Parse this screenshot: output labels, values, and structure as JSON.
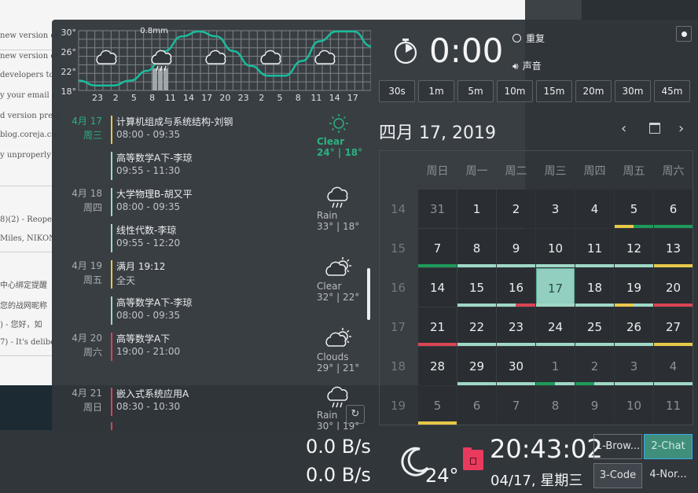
{
  "background": {
    "lines": [
      {
        "text": "new version of",
        "y": 40
      },
      {
        "text": "new version of",
        "y": 66
      },
      {
        "text": "developers to",
        "y": 90
      },
      {
        "text": "y your email s",
        "y": 116
      },
      {
        "text": "d version pre-c",
        "y": 142
      },
      {
        "text": "blog.coreja.co",
        "y": 166
      },
      {
        "text": "y unproperly (",
        "y": 192
      },
      {
        "text": "8)(2)  - Reope",
        "y": 274
      },
      {
        "text": "Miles, NIKON",
        "y": 298
      },
      {
        "text": "中心绑定提醒",
        "y": 354
      },
      {
        "text": "您的战网昵称",
        "y": 380
      },
      {
        "text": ")  - 您好，如",
        "y": 404
      },
      {
        "text": "7)  - It's delibe",
        "y": 430
      }
    ]
  },
  "weather_chart": {
    "rain_label": "0.8mm",
    "y_ticks": [
      "30°",
      "26°",
      "22°",
      "18°"
    ],
    "x_ticks": [
      "23",
      "2",
      "5",
      "8",
      "11",
      "14",
      "17",
      "20",
      "23",
      "2",
      "5",
      "8",
      "11",
      "14",
      "17"
    ],
    "temps": [
      20,
      19,
      19,
      20,
      22,
      26,
      29,
      30,
      29,
      26,
      23,
      21,
      21,
      24,
      28,
      30,
      30,
      27
    ]
  },
  "events": [
    {
      "date": "4月 17",
      "weekday": "周三",
      "today": true,
      "items": [
        {
          "title": "计算机组成与系统结构-刘钢",
          "time": "08:00 - 09:35",
          "color": "#e8c84a"
        },
        {
          "title": "高等数学A下-李琼",
          "time": "09:55 - 11:30",
          "color": "#9fd9c6"
        }
      ]
    },
    {
      "date": "4月 18",
      "weekday": "周四",
      "items": [
        {
          "title": "大学物理B-胡又平",
          "time": "08:00 - 09:35",
          "color": "#9fd9c6"
        },
        {
          "title": "线性代数-李琼",
          "time": "09:55 - 12:20",
          "color": "#9fd9c6"
        }
      ]
    },
    {
      "date": "4月 19",
      "weekday": "周五",
      "items": [
        {
          "title": "满月 19:12",
          "time": "全天",
          "color": "#e8c84a"
        },
        {
          "title": "高等数学A下-李琼",
          "time": "08:00 - 09:35",
          "color": "#9fd9c6"
        }
      ]
    },
    {
      "date": "4月 20",
      "weekday": "周六",
      "items": [
        {
          "title": "高等数学A下",
          "time": "19:00 - 21:00",
          "color": "#da4453"
        }
      ]
    },
    {
      "date": "4月 21",
      "weekday": "周日",
      "items": [
        {
          "title": "嵌入式系统应用A",
          "time": "08:30 - 10:30",
          "color": "#da4453"
        }
      ]
    }
  ],
  "forecast": [
    {
      "desc": "Clear",
      "temp": "24° | 18°",
      "icon": "sun-icon"
    },
    {
      "desc": "Rain",
      "temp": "33° | 18°",
      "icon": "rain-cloud-icon"
    },
    {
      "desc": "Clear",
      "temp": "32° | 22°",
      "icon": "partly-cloudy-icon"
    },
    {
      "desc": "Clouds",
      "temp": "29° | 21°",
      "icon": "partly-cloudy-icon"
    },
    {
      "desc": "Rain",
      "temp": "30° | 19°",
      "icon": "rain-cloud-icon"
    }
  ],
  "timer": {
    "display": "0:00",
    "repeat_label": "重复",
    "sound_label": "声音",
    "presets": [
      "30s",
      "1m",
      "5m",
      "10m",
      "15m",
      "20m",
      "30m",
      "45m"
    ]
  },
  "calendar": {
    "title": "四月 17, 2019",
    "weekdays": [
      "周日",
      "周一",
      "周二",
      "周三",
      "周四",
      "周五",
      "周六"
    ],
    "weeks": [
      "14",
      "15",
      "16",
      "17",
      "18",
      "19"
    ],
    "days": [
      [
        "31",
        "1",
        "2",
        "3",
        "4",
        "5",
        "6"
      ],
      [
        "7",
        "8",
        "9",
        "10",
        "11",
        "12",
        "13"
      ],
      [
        "14",
        "15",
        "16",
        "17",
        "18",
        "19",
        "20"
      ],
      [
        "21",
        "22",
        "23",
        "24",
        "25",
        "26",
        "27"
      ],
      [
        "28",
        "29",
        "30",
        "1",
        "2",
        "3",
        "4"
      ],
      [
        "5",
        "6",
        "7",
        "8",
        "9",
        "10",
        "11"
      ]
    ],
    "today_index": [
      2,
      3
    ]
  },
  "taskbar": {
    "net_down": "0.0 B/s",
    "net_up": "0.0 B/s",
    "temperature": "24°",
    "clock": "20:43:02",
    "date": "04/17, 星期三",
    "pager": [
      "1-Brow...",
      "2-Chat",
      "3-Code",
      "4-Nor..."
    ]
  }
}
